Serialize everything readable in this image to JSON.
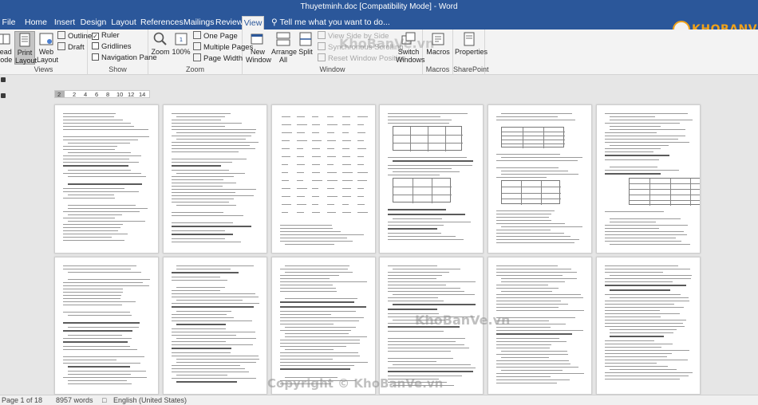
{
  "window": {
    "title": "Thuyetminh.doc [Compatibility Mode] - Word"
  },
  "brand": {
    "logo_text": "KHOBANVE"
  },
  "tabs": [
    {
      "label": "File"
    },
    {
      "label": "Home"
    },
    {
      "label": "Insert"
    },
    {
      "label": "Design"
    },
    {
      "label": "Layout"
    },
    {
      "label": "References"
    },
    {
      "label": "Mailings"
    },
    {
      "label": "Review"
    },
    {
      "label": "View"
    }
  ],
  "tell_me": "Tell me what you want to do...",
  "ribbon": {
    "views": {
      "label": "Views",
      "read_mode": "Read Mode",
      "print_layout": "Print Layout",
      "web_layout": "Web Layout",
      "outline": "Outline",
      "draft": "Draft"
    },
    "show": {
      "label": "Show",
      "ruler": "Ruler",
      "ruler_checked": true,
      "gridlines": "Gridlines",
      "navigation_pane": "Navigation Pane"
    },
    "zoom": {
      "label": "Zoom",
      "zoom": "Zoom",
      "hundred": "100%",
      "one_page": "One Page",
      "multiple_pages": "Multiple Pages",
      "page_width": "Page Width"
    },
    "window": {
      "label": "Window",
      "new_window": "New Window",
      "arrange_all": "Arrange All",
      "split": "Split",
      "view_side_by_side": "View Side by Side",
      "synchronous_scrolling": "Synchronous Scrolling",
      "reset_window_position": "Reset Window Position",
      "switch_windows": "Switch Windows"
    },
    "macros": {
      "label": "Macros",
      "macros": "Macros"
    },
    "sharepoint": {
      "label": "SharePoint",
      "properties": "Properties"
    }
  },
  "ruler": {
    "numbers": [
      "2",
      "2",
      "4",
      "6",
      "8",
      "10",
      "12",
      "14"
    ]
  },
  "status": {
    "page": "Page 1 of 18",
    "words": "8957 words",
    "language": "English (United States)"
  },
  "watermarks": [
    "KhoBanVe.vn",
    "Copyright © KhoBanVe.vn"
  ]
}
